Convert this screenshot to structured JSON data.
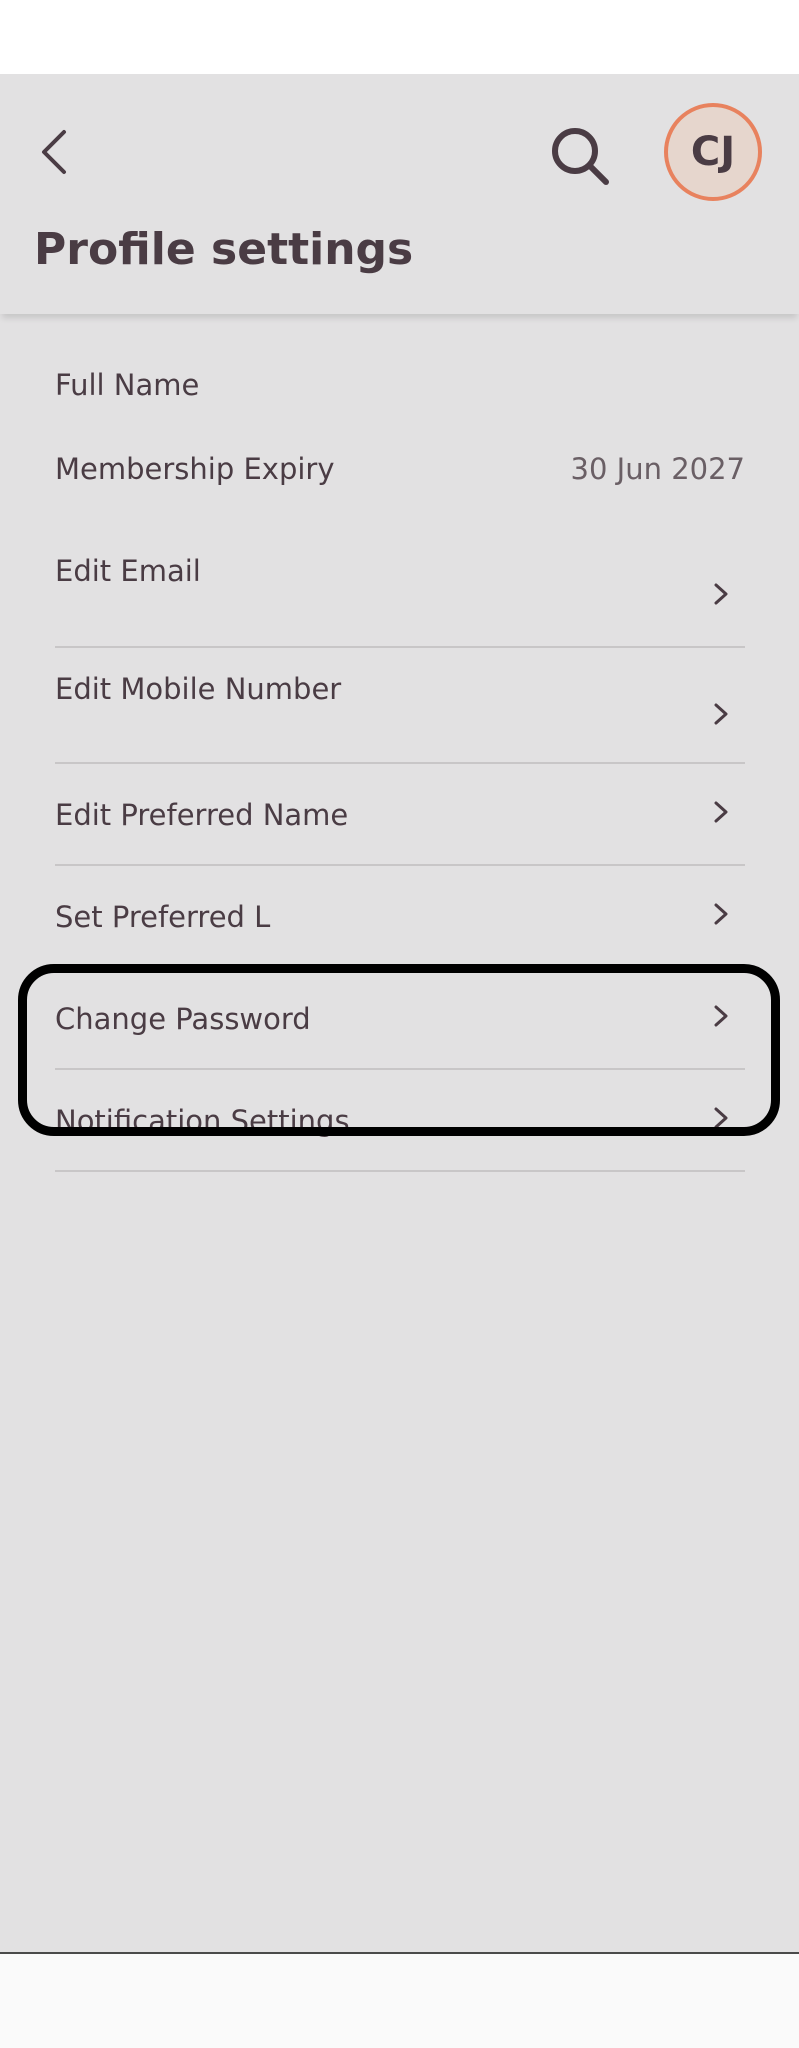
{
  "header": {
    "title": "Profile settings",
    "back_icon": "chevron-left-icon",
    "search_icon": "search-icon",
    "avatar_initials": "CJ",
    "avatar_border_color": "#e8825e"
  },
  "info": {
    "full_name_label": "Full Name",
    "full_name_value": "",
    "membership_label": "Membership Expiry",
    "membership_value": "30 Jun 2027"
  },
  "menu": {
    "edit_email": "Edit Email",
    "edit_mobile": "Edit Mobile Number",
    "edit_preferred_name": "Edit Preferred Name",
    "set_preferred": "Set Preferred L",
    "change_password": "Change Password",
    "notification_settings": "Notification Settings",
    "chevron_icon": "chevron-right-icon"
  },
  "colors": {
    "background": "#e2e1e2",
    "text": "#4a3c44",
    "divider": "#c8c6c7",
    "highlight": "#000000"
  }
}
